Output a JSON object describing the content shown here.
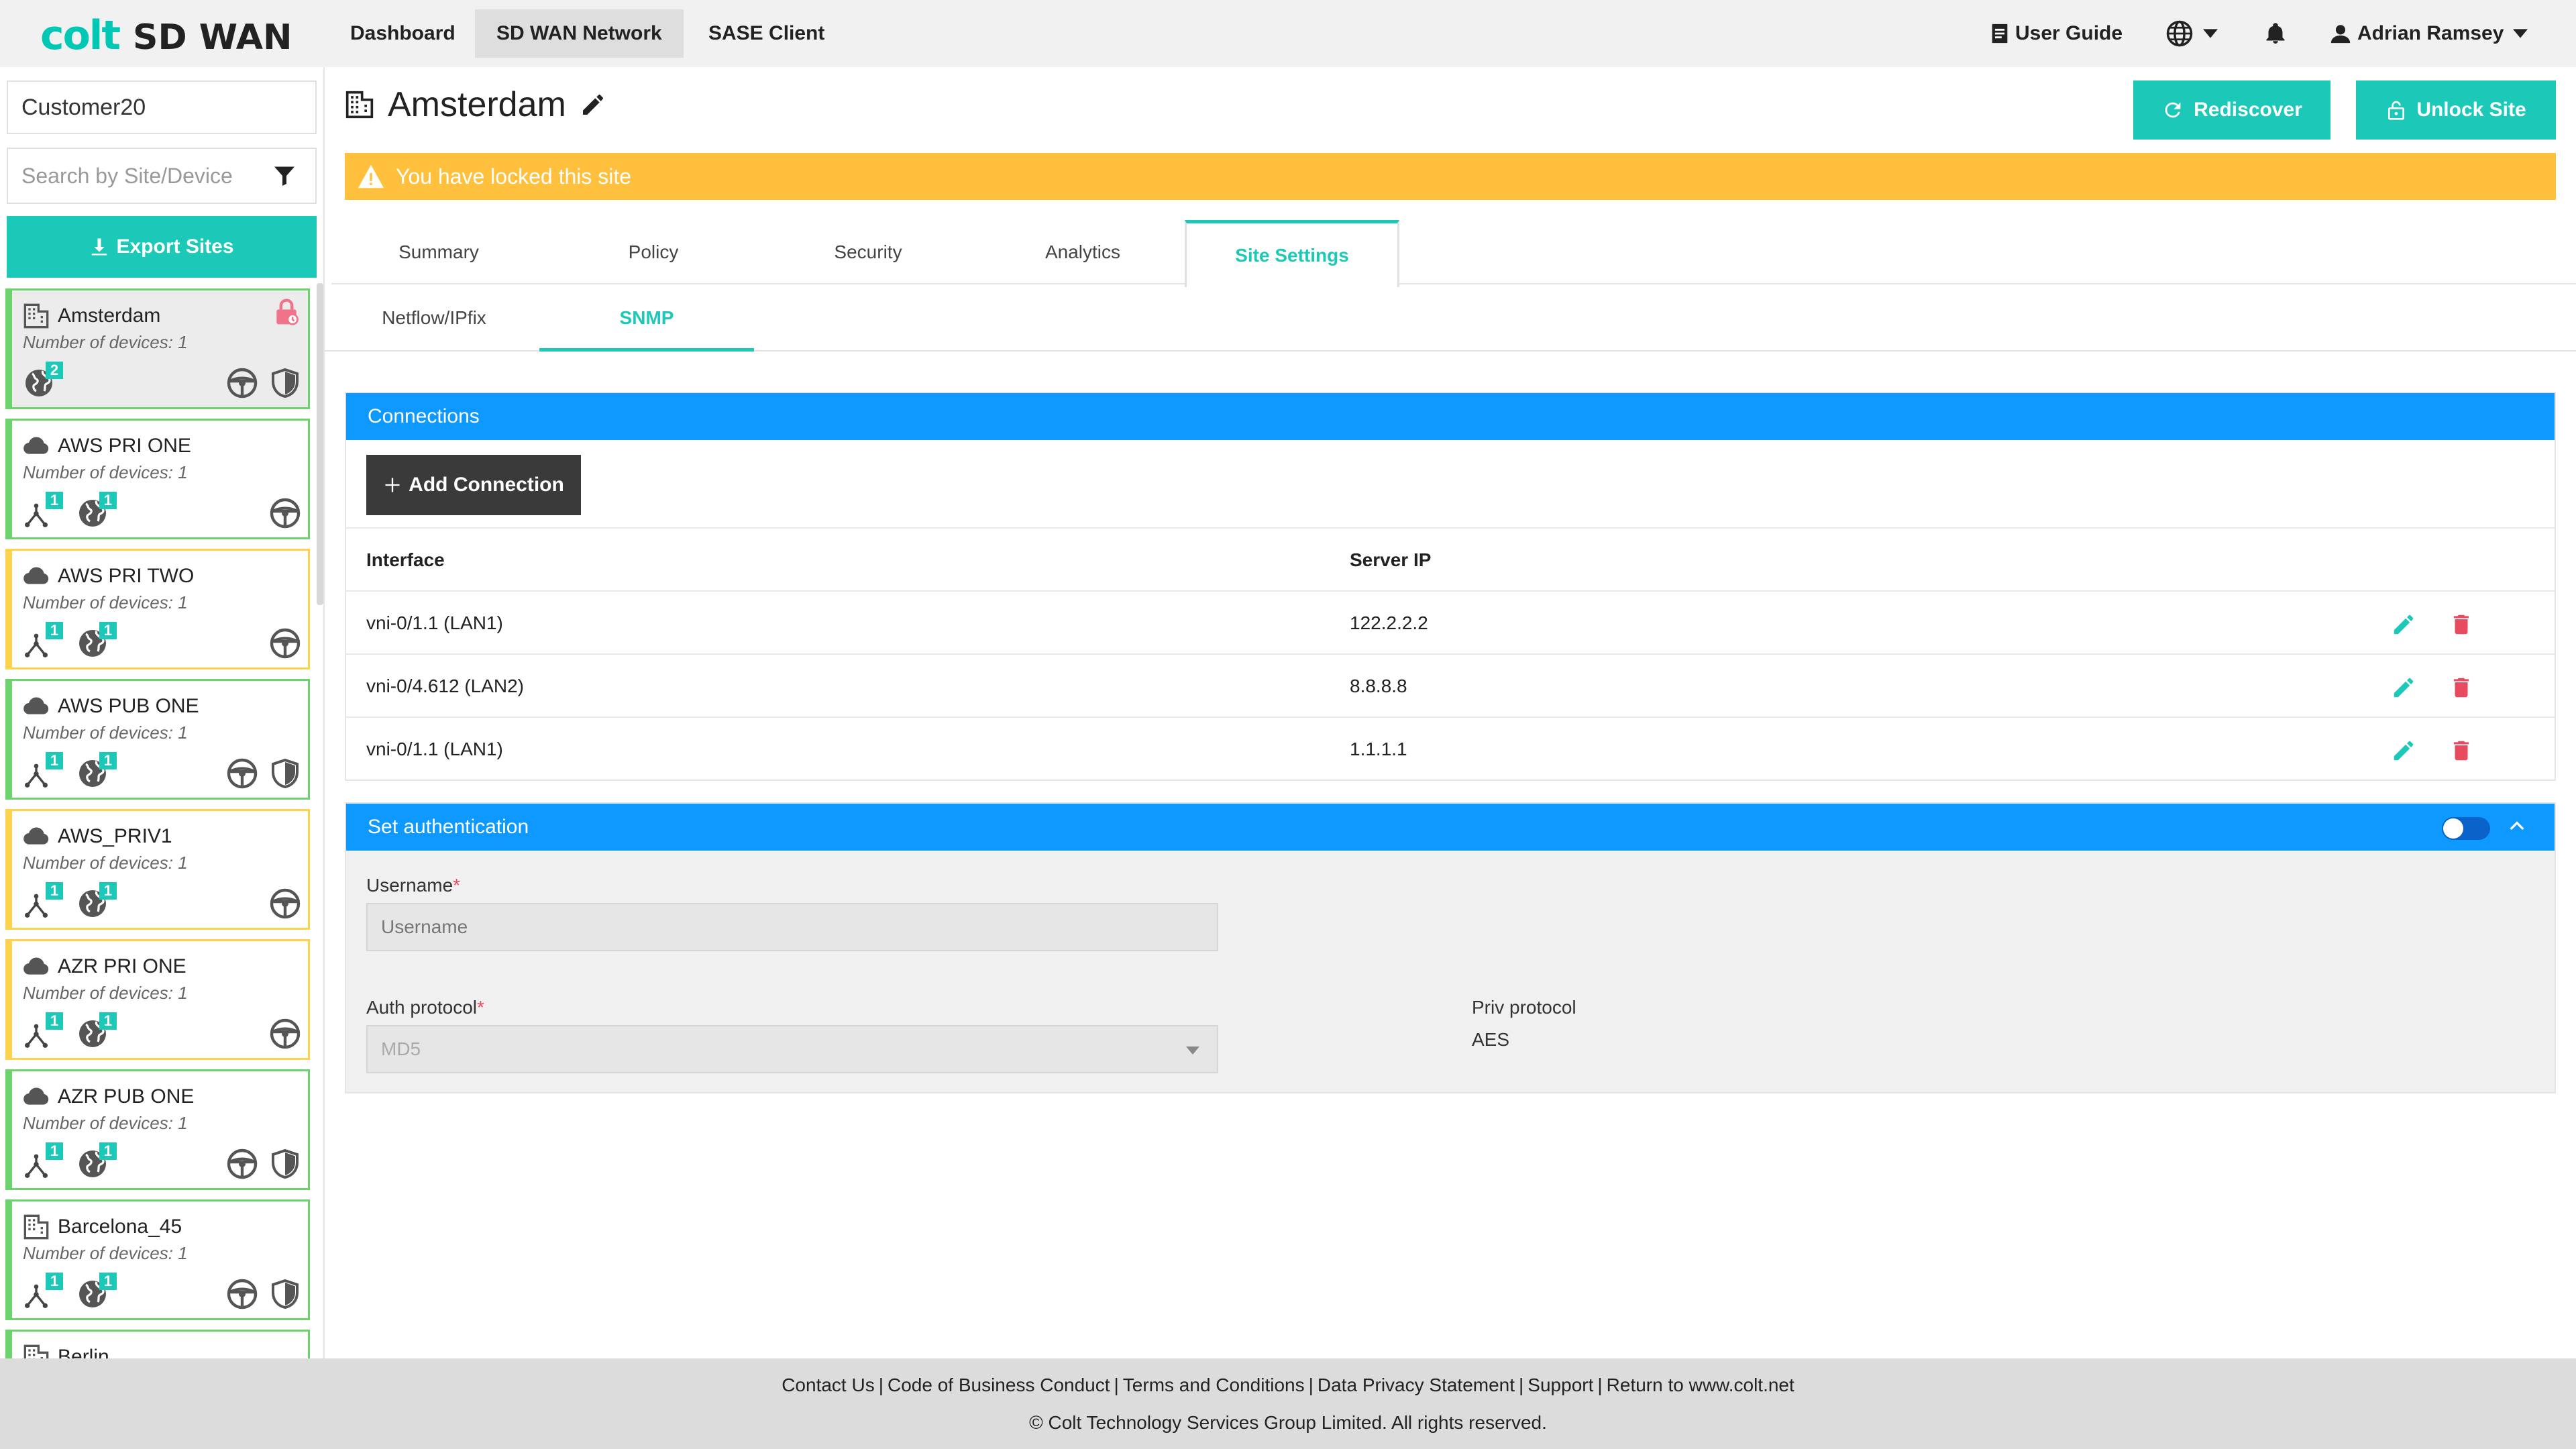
{
  "header": {
    "brand": "colt",
    "product": "SD WAN",
    "nav": [
      "Dashboard",
      "SD WAN Network",
      "SASE Client"
    ],
    "active_nav": "SD WAN Network",
    "user_guide": "User Guide",
    "user_name": "Adrian Ramsey"
  },
  "sidebar": {
    "customer": "Customer20",
    "search_placeholder": "Search by Site/Device",
    "export_label": "Export Sites",
    "sites": [
      {
        "name": "Amsterdam",
        "type": "building",
        "devices": "Number of devices: 1",
        "status": "green",
        "selected": true,
        "locked": true,
        "badges": [
          "2"
        ],
        "security": true
      },
      {
        "name": "AWS PRI ONE",
        "type": "cloud",
        "devices": "Number of devices: 1",
        "status": "green",
        "badges": [
          "1",
          "1"
        ],
        "security": false
      },
      {
        "name": "AWS PRI TWO",
        "type": "cloud",
        "devices": "Number of devices: 1",
        "status": "amber",
        "badges": [
          "1",
          "1"
        ],
        "security": false
      },
      {
        "name": "AWS PUB ONE",
        "type": "cloud",
        "devices": "Number of devices: 1",
        "status": "green",
        "badges": [
          "1",
          "1"
        ],
        "security": true
      },
      {
        "name": "AWS_PRIV1",
        "type": "cloud",
        "devices": "Number of devices: 1",
        "status": "amber",
        "badges": [
          "1",
          "1"
        ],
        "security": false
      },
      {
        "name": "AZR PRI ONE",
        "type": "cloud",
        "devices": "Number of devices: 1",
        "status": "amber",
        "badges": [
          "1",
          "1"
        ],
        "security": false
      },
      {
        "name": "AZR PUB ONE",
        "type": "cloud",
        "devices": "Number of devices: 1",
        "status": "green",
        "badges": [
          "1",
          "1"
        ],
        "security": true
      },
      {
        "name": "Barcelona_45",
        "type": "building",
        "devices": "Number of devices: 1",
        "status": "green",
        "badges": [
          "1",
          "1"
        ],
        "security": true
      },
      {
        "name": "Berlin",
        "type": "building",
        "devices": "",
        "status": "green",
        "badges": [],
        "security": false
      }
    ]
  },
  "main": {
    "site_title": "Amsterdam",
    "rediscover_label": "Rediscover",
    "unlock_label": "Unlock Site",
    "warning": "You have locked this site",
    "tabs": [
      "Summary",
      "Policy",
      "Security",
      "Analytics",
      "Site Settings"
    ],
    "active_tab": "Site Settings",
    "subtabs": [
      "Netflow/IPfix",
      "SNMP"
    ],
    "active_subtab": "SNMP"
  },
  "connections": {
    "header": "Connections",
    "add_label": "Add Connection",
    "columns": [
      "Interface",
      "Server IP"
    ],
    "rows": [
      {
        "interface": "vni-0/1.1 (LAN1)",
        "server_ip": "122.2.2.2"
      },
      {
        "interface": "vni-0/4.612 (LAN2)",
        "server_ip": "8.8.8.8"
      },
      {
        "interface": "vni-0/1.1 (LAN1)",
        "server_ip": "1.1.1.1"
      }
    ]
  },
  "auth": {
    "header": "Set authentication",
    "toggle_on": true,
    "username_label": "Username",
    "username_placeholder": "Username",
    "auth_protocol_label": "Auth protocol",
    "auth_protocol_value": "MD5",
    "priv_protocol_label": "Priv protocol",
    "priv_protocol_value": "AES",
    "required_mark": "*"
  },
  "footer": {
    "links": [
      "Contact Us",
      "Code of Business Conduct",
      "Terms and Conditions",
      "Data Privacy Statement",
      "Support",
      "Return to www.colt.net"
    ],
    "separator": "|",
    "copyright": "© Colt Technology Services Group Limited. All rights reserved."
  },
  "colors": {
    "teal": "#1cc9b8",
    "blue_header": "#0d99ff",
    "warning": "#ffc13d",
    "delete_red": "#e84a5f",
    "status_green": "#6cd36c",
    "status_amber": "#ffd24d"
  },
  "icons": {
    "building": "building-icon",
    "cloud": "cloud-icon",
    "globe": "globe-icon",
    "network": "network-icon",
    "wheel": "steering-wheel-icon",
    "shield": "shield-icon"
  }
}
